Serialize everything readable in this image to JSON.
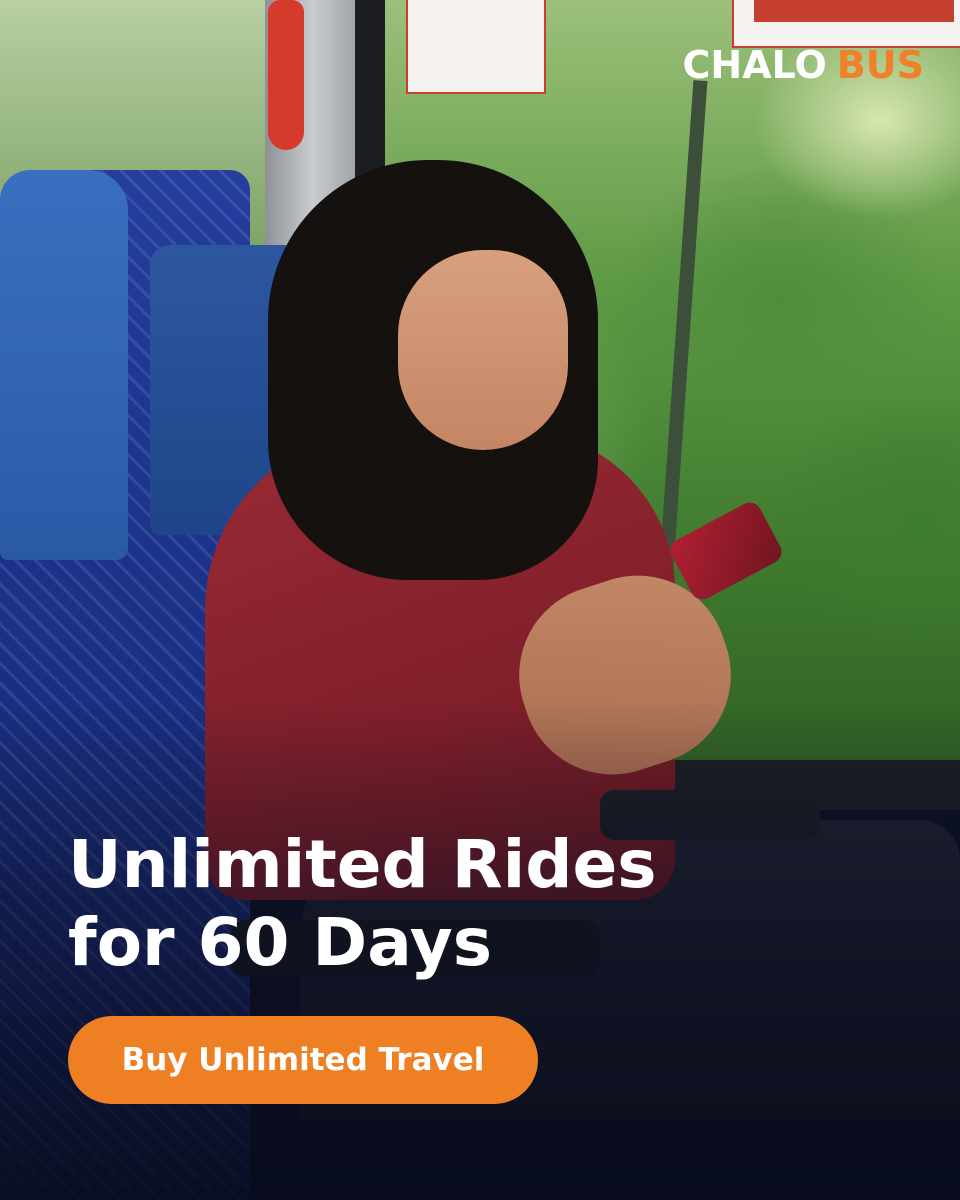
{
  "brand": {
    "name_part1": "CHALO",
    "name_part2": "BUS",
    "primary_color": "#ffffff",
    "accent_color": "#f0802a"
  },
  "headline": {
    "line1": "Unlimited Rides",
    "line2": "for 60 Days"
  },
  "cta": {
    "label": "Buy Unlimited Travel",
    "background_color": "#ef7f23"
  }
}
